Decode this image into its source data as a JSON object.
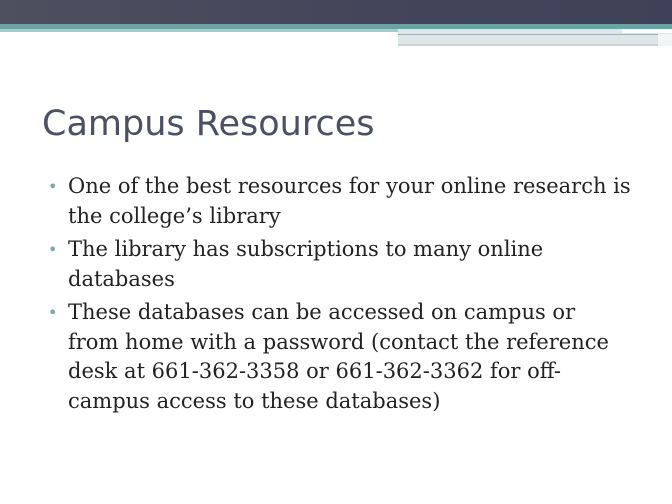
{
  "slide": {
    "title": "Campus Resources",
    "bullet_symbol": "•",
    "bullets": [
      "One of the best resources for your online research is the college’s library",
      "The library has subscriptions to many online databases",
      "These databases can be accessed on campus or from home with a password (contact the reference desk at 661-362-3358 or 661-362-3362 for off-campus access to these databases)"
    ]
  },
  "colors": {
    "header_dark": "#44455a",
    "header_teal": "#6aa3a3",
    "title_text": "#4b5163",
    "bullet_marker": "#72a9ab",
    "body_text": "#222222"
  }
}
